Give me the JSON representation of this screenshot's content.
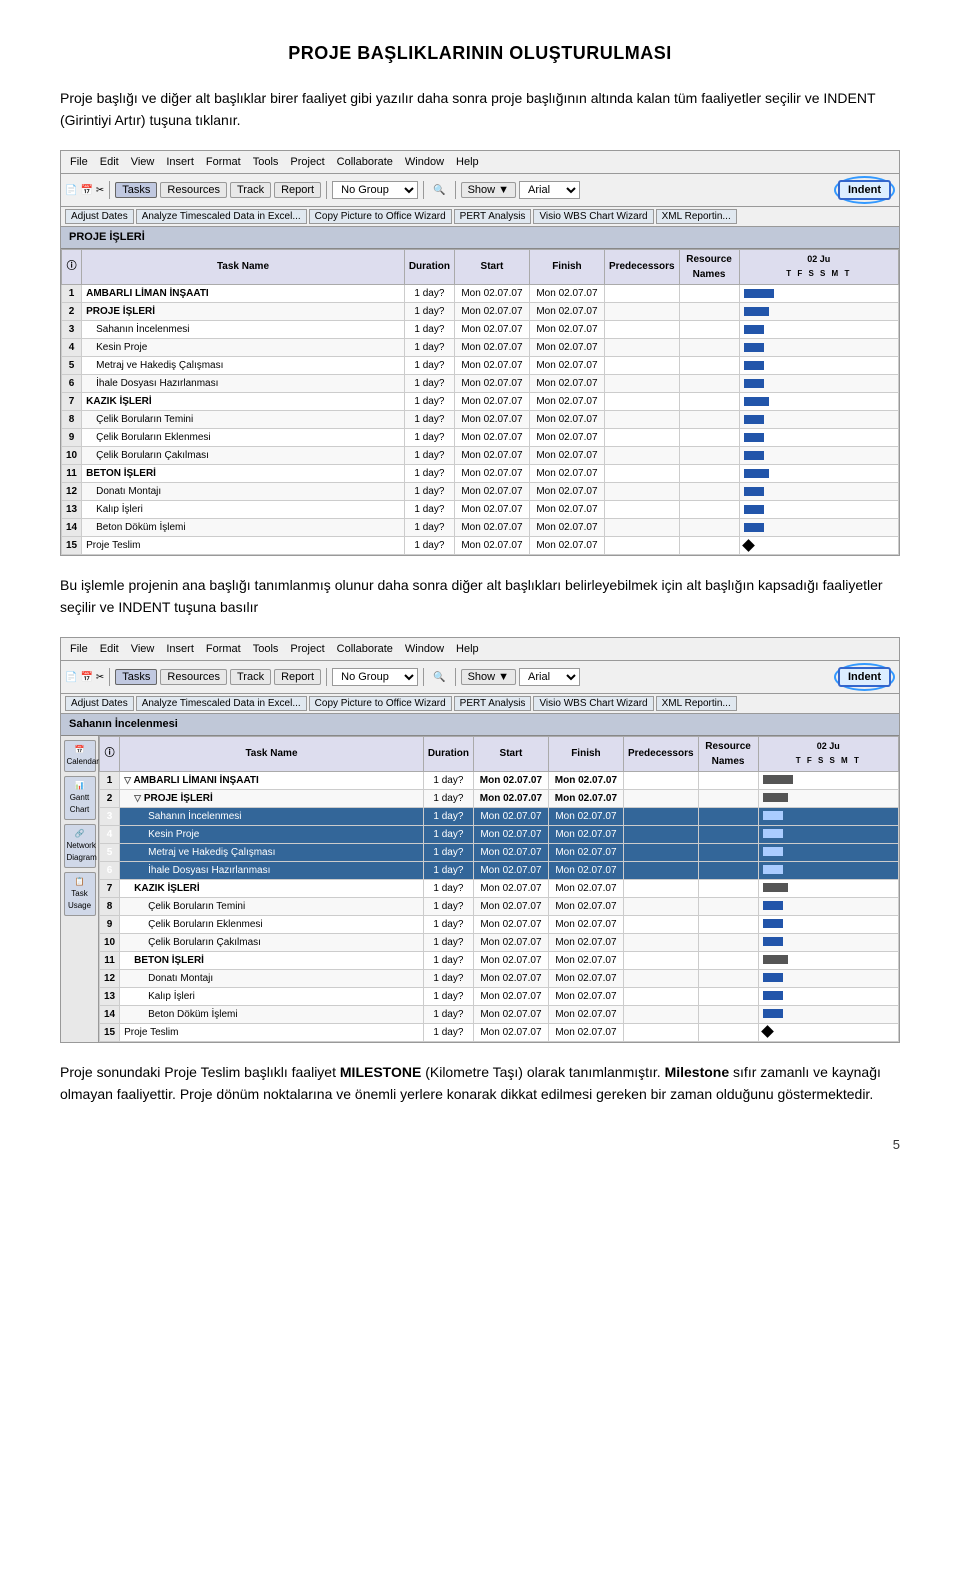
{
  "page": {
    "title": "PROJE BAŞLIKLARININ OLUŞTURULMASI",
    "page_number": "5"
  },
  "paragraph1": "Proje başlığı ve diğer alt başlıklar birer faaliyet gibi yazılır daha sonra proje başlığının altında kalan tüm faaliyetler seçilir ve INDENT (Girintiyi Artır) tuşuna tıklanır.",
  "screenshot1": {
    "menubar": [
      "File",
      "Edit",
      "View",
      "Insert",
      "Format",
      "Tools",
      "Project",
      "Collaborate",
      "Window",
      "Help"
    ],
    "toolbar": {
      "tasks_btn": "Tasks",
      "resources_btn": "Resources",
      "track_btn": "Track",
      "report_btn": "Report",
      "no_group": "No Group",
      "show_btn": "Show ▼",
      "font": "Arial",
      "indent_btn": "Indent"
    },
    "toolbar2": {
      "adjust_dates": "Adjust Dates",
      "analyze": "Analyze Timescaled Data in Excel...",
      "copy_picture": "Copy Picture to Office Wizard",
      "pert": "PERT Analysis",
      "visio": "Visio WBS Chart Wizard",
      "xml": "XML Reportin..."
    },
    "view_title": "PROJE İŞLERİ",
    "columns": [
      "",
      "Task Name",
      "Duration",
      "Start",
      "Finish",
      "Predecessors",
      "Resource Names"
    ],
    "gantt_date": "02 Ju",
    "gantt_days": [
      "T",
      "F",
      "S",
      "S",
      "M",
      "T"
    ],
    "rows": [
      {
        "id": 1,
        "name": "AMBARLI LİMAN İNŞAATI",
        "duration": "1 day?",
        "start": "Mon 02.07.07",
        "finish": "Mon 02.07.07",
        "pred": "",
        "res": "",
        "level": 0,
        "bold": true
      },
      {
        "id": 2,
        "name": "PROJE İŞLERİ",
        "duration": "1 day?",
        "start": "Mon 02.07.07",
        "finish": "Mon 02.07.07",
        "pred": "",
        "res": "",
        "level": 0,
        "bold": true
      },
      {
        "id": 3,
        "name": "Sahanın İncelenmesi",
        "duration": "1 day?",
        "start": "Mon 02.07.07",
        "finish": "Mon 02.07.07",
        "pred": "",
        "res": "",
        "level": 1,
        "bold": false
      },
      {
        "id": 4,
        "name": "Kesin Proje",
        "duration": "1 day?",
        "start": "Mon 02.07.07",
        "finish": "Mon 02.07.07",
        "pred": "",
        "res": "",
        "level": 1,
        "bold": false
      },
      {
        "id": 5,
        "name": "Metraj ve Hakediş Çalışması",
        "duration": "1 day?",
        "start": "Mon 02.07.07",
        "finish": "Mon 02.07.07",
        "pred": "",
        "res": "",
        "level": 1,
        "bold": false
      },
      {
        "id": 6,
        "name": "İhale Dosyası Hazırlanması",
        "duration": "1 day?",
        "start": "Mon 02.07.07",
        "finish": "Mon 02.07.07",
        "pred": "",
        "res": "",
        "level": 1,
        "bold": false
      },
      {
        "id": 7,
        "name": "KAZIK İŞLERİ",
        "duration": "1 day?",
        "start": "Mon 02.07.07",
        "finish": "Mon 02.07.07",
        "pred": "",
        "res": "",
        "level": 0,
        "bold": true
      },
      {
        "id": 8,
        "name": "Çelik Boruların Temini",
        "duration": "1 day?",
        "start": "Mon 02.07.07",
        "finish": "Mon 02.07.07",
        "pred": "",
        "res": "",
        "level": 1,
        "bold": false
      },
      {
        "id": 9,
        "name": "Çelik Boruların Eklenmesi",
        "duration": "1 day?",
        "start": "Mon 02.07.07",
        "finish": "Mon 02.07.07",
        "pred": "",
        "res": "",
        "level": 1,
        "bold": false
      },
      {
        "id": 10,
        "name": "Çelik Boruların Çakılması",
        "duration": "1 day?",
        "start": "Mon 02.07.07",
        "finish": "Mon 02.07.07",
        "pred": "",
        "res": "",
        "level": 1,
        "bold": false
      },
      {
        "id": 11,
        "name": "BETON İŞLERİ",
        "duration": "1 day?",
        "start": "Mon 02.07.07",
        "finish": "Mon 02.07.07",
        "pred": "",
        "res": "",
        "level": 0,
        "bold": true
      },
      {
        "id": 12,
        "name": "Donatı Montajı",
        "duration": "1 day?",
        "start": "Mon 02.07.07",
        "finish": "Mon 02.07.07",
        "pred": "",
        "res": "",
        "level": 1,
        "bold": false
      },
      {
        "id": 13,
        "name": "Kalıp İşleri",
        "duration": "1 day?",
        "start": "Mon 02.07.07",
        "finish": "Mon 02.07.07",
        "pred": "",
        "res": "",
        "level": 1,
        "bold": false
      },
      {
        "id": 14,
        "name": "Beton Döküm İşlemi",
        "duration": "1 day?",
        "start": "Mon 02.07.07",
        "finish": "Mon 02.07.07",
        "pred": "",
        "res": "",
        "level": 1,
        "bold": false
      },
      {
        "id": 15,
        "name": "Proje Teslim",
        "duration": "1 day?",
        "start": "Mon 02.07.07",
        "finish": "Mon 02.07.07",
        "pred": "",
        "res": "",
        "level": 0,
        "bold": false
      }
    ]
  },
  "paragraph2": "Bu işlemle projenin ana başlığı tanımlanmış olunur daha sonra diğer alt başlıkları belirleyebilmek için alt başlığın kapsadığı faaliyetler seçilir ve INDENT tuşuna basılır",
  "screenshot2": {
    "menubar": [
      "File",
      "Edit",
      "View",
      "Insert",
      "Format",
      "Tools",
      "Project",
      "Collaborate",
      "Window",
      "Help"
    ],
    "toolbar": {
      "tasks_btn": "Tasks",
      "resources_btn": "Resources",
      "track_btn": "Track",
      "report_btn": "Report",
      "no_group": "No Group",
      "show_btn": "Show ▼",
      "font": "Arial",
      "indent_btn": "Indent"
    },
    "toolbar2": {
      "adjust_dates": "Adjust Dates",
      "analyze": "Analyze Timescaled Data in Excel...",
      "copy_picture": "Copy Picture to Office Wizard",
      "pert": "PERT Analysis",
      "visio": "Visio WBS Chart Wizard",
      "xml": "XML Reportin..."
    },
    "view_title": "Sahanın İncelenmesi",
    "sidebar_icons": [
      "Calendar",
      "Gantt Chart",
      "Network Diagram",
      "Task Usage"
    ],
    "rows": [
      {
        "id": 1,
        "name": "AMBARLI LİMANI İNŞAATI",
        "duration": "1 day?",
        "start": "Mon 02.07.07",
        "finish": "Mon 02.07.07",
        "pred": "",
        "res": "",
        "level": 0,
        "bold": true,
        "collapse": true
      },
      {
        "id": 2,
        "name": "PROJE İŞLERİ",
        "duration": "1 day?",
        "start": "Mon 02.07.07",
        "finish": "Mon 02.07.07",
        "pred": "",
        "res": "",
        "level": 1,
        "bold": true,
        "collapse": true
      },
      {
        "id": 3,
        "name": "Sahanın İncelenmesi",
        "duration": "1 day?",
        "start": "Mon 02.07.07",
        "finish": "Mon 02.07.07",
        "pred": "",
        "res": "",
        "level": 2,
        "bold": false,
        "selected": true
      },
      {
        "id": 4,
        "name": "Kesin Proje",
        "duration": "1 day?",
        "start": "Mon 02.07.07",
        "finish": "Mon 02.07.07",
        "pred": "",
        "res": "",
        "level": 2,
        "bold": false,
        "selected": true
      },
      {
        "id": 5,
        "name": "Metraj ve Hakediş Çalışması",
        "duration": "1 day?",
        "start": "Mon 02.07.07",
        "finish": "Mon 02.07.07",
        "pred": "",
        "res": "",
        "level": 2,
        "bold": false,
        "selected": true
      },
      {
        "id": 6,
        "name": "İhale Dosyası Hazırlanması",
        "duration": "1 day?",
        "start": "Mon 02.07.07",
        "finish": "Mon 02.07.07",
        "pred": "",
        "res": "",
        "level": 2,
        "bold": false,
        "selected": true
      },
      {
        "id": 7,
        "name": "KAZIK İŞLERİ",
        "duration": "1 day?",
        "start": "Mon 02.07.07",
        "finish": "Mon 02.07.07",
        "pred": "",
        "res": "",
        "level": 1,
        "bold": true
      },
      {
        "id": 8,
        "name": "Çelik Boruların Temini",
        "duration": "1 day?",
        "start": "Mon 02.07.07",
        "finish": "Mon 02.07.07",
        "pred": "",
        "res": "",
        "level": 2,
        "bold": false
      },
      {
        "id": 9,
        "name": "Çelik Boruların Eklenmesi",
        "duration": "1 day?",
        "start": "Mon 02.07.07",
        "finish": "Mon 02.07.07",
        "pred": "",
        "res": "",
        "level": 2,
        "bold": false
      },
      {
        "id": 10,
        "name": "Çelik Boruların Çakılması",
        "duration": "1 day?",
        "start": "Mon 02.07.07",
        "finish": "Mon 02.07.07",
        "pred": "",
        "res": "",
        "level": 2,
        "bold": false
      },
      {
        "id": 11,
        "name": "BETON İŞLERİ",
        "duration": "1 day?",
        "start": "Mon 02.07.07",
        "finish": "Mon 02.07.07",
        "pred": "",
        "res": "",
        "level": 1,
        "bold": true
      },
      {
        "id": 12,
        "name": "Donatı Montajı",
        "duration": "1 day?",
        "start": "Mon 02.07.07",
        "finish": "Mon 02.07.07",
        "pred": "",
        "res": "",
        "level": 2,
        "bold": false
      },
      {
        "id": 13,
        "name": "Kalıp İşleri",
        "duration": "1 day?",
        "start": "Mon 02.07.07",
        "finish": "Mon 02.07.07",
        "pred": "",
        "res": "",
        "level": 2,
        "bold": false
      },
      {
        "id": 14,
        "name": "Beton Döküm İşlemi",
        "duration": "1 day?",
        "start": "Mon 02.07.07",
        "finish": "Mon 02.07.07",
        "pred": "",
        "res": "",
        "level": 2,
        "bold": false
      },
      {
        "id": 15,
        "name": "Proje Teslim",
        "duration": "1 day?",
        "start": "Mon 02.07.07",
        "finish": "Mon 02.07.07",
        "pred": "",
        "res": "",
        "level": 0,
        "bold": false
      }
    ]
  },
  "paragraph3a": "Proje sonundaki Proje Teslim başlıklı faaliyet ",
  "paragraph3b": "MILESTONE",
  "paragraph3c": " (Kilometre Taşı) olarak tanımlanmıştır. ",
  "paragraph3d": "Milestone",
  "paragraph3e": " sıfır zamanlı ve kaynağı olmayan faaliyettir. Proje dönüm noktalarına ve önemli yerlere konarak dikkat edilmesi gereken bir zaman olduğunu göstermektedir.",
  "indent_label": "Indent",
  "show_label": "Show ▼"
}
